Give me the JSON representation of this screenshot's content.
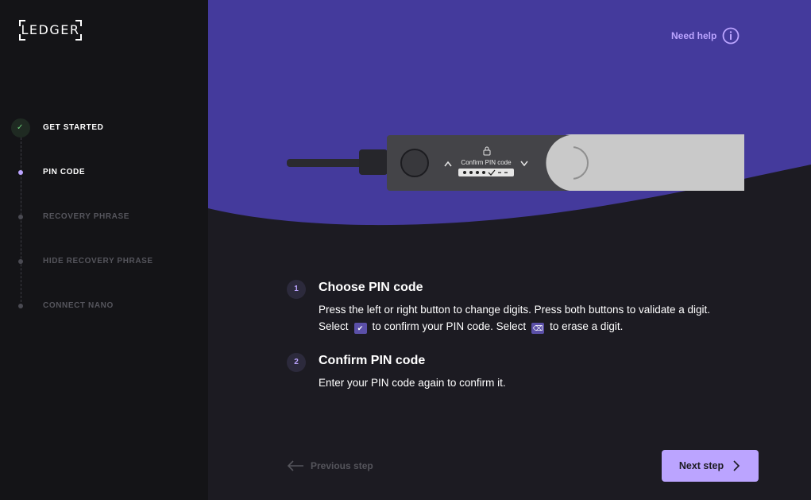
{
  "brand": {
    "logo_text": "LEDGER"
  },
  "steps": [
    {
      "label": "GET STARTED",
      "state": "done"
    },
    {
      "label": "PIN CODE",
      "state": "active"
    },
    {
      "label": "RECOVERY PHRASE",
      "state": "todo"
    },
    {
      "label": "HIDE RECOVERY PHRASE",
      "state": "todo"
    },
    {
      "label": "CONNECT NANO",
      "state": "todo"
    }
  ],
  "help": {
    "label": "Need help",
    "icon": "info-icon"
  },
  "device": {
    "screen_text": "Confirm PIN code"
  },
  "instructions": [
    {
      "number": "1",
      "title": "Choose PIN code",
      "line1": "Press the left or right button to change digits. Press both buttons to validate a digit.",
      "line2_a": "Select",
      "line2_b": "to confirm your PIN code. Select",
      "line2_c": "to erase a digit."
    },
    {
      "number": "2",
      "title": "Confirm PIN code",
      "line1": "Enter your PIN code again to confirm it."
    }
  ],
  "nav": {
    "previous_label": "Previous step",
    "next_label": "Next step"
  },
  "colors": {
    "accent": "#bba4ff",
    "hero_purple": "#443a9c",
    "background": "#1c1b22",
    "sidebar": "#141417",
    "done_check": "#6bd07b"
  }
}
